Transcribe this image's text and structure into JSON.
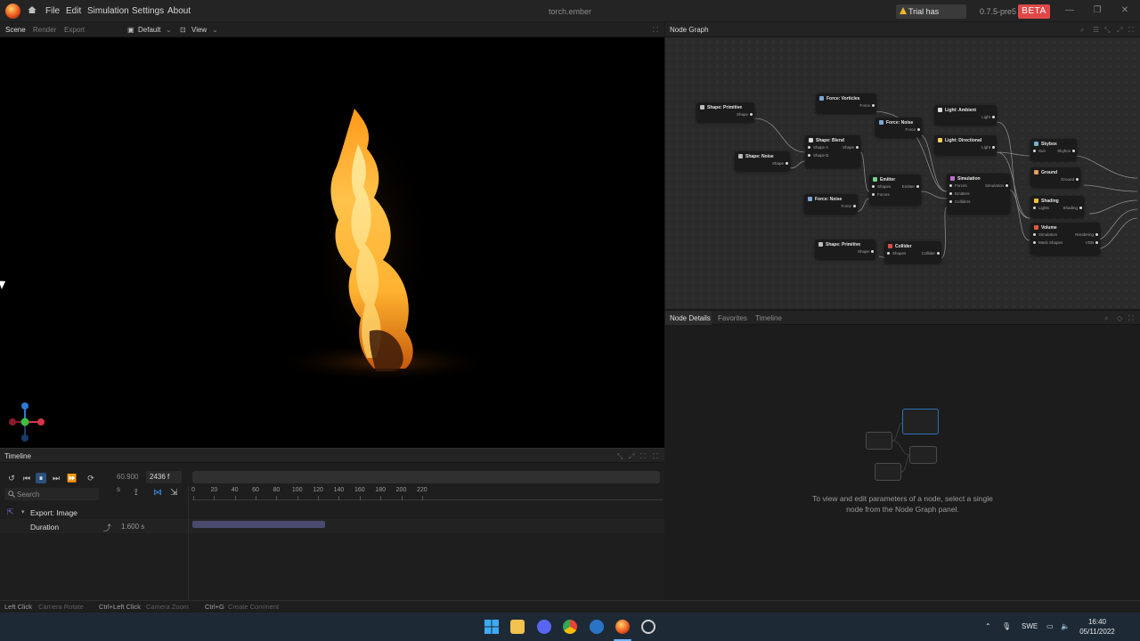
{
  "window": {
    "title": "torch.ember",
    "menu": [
      "File",
      "Edit",
      "Simulation",
      "Settings",
      "About"
    ],
    "trial_label": "Trial has expired",
    "version": "0.7.5-pre5",
    "beta_label": "BETA"
  },
  "scene": {
    "tabs": [
      "Scene",
      "Render",
      "Export"
    ],
    "camera_label": "Default",
    "view_label": "View"
  },
  "timeline": {
    "title": "Timeline",
    "time_value": "60.900 s",
    "frame_value": "2436 f",
    "search_placeholder": "Search",
    "ruler_ticks": [
      "0",
      "20",
      "40",
      "60",
      "80",
      "100",
      "120",
      "140",
      "160",
      "180",
      "200",
      "220"
    ],
    "export_label": "Export: Image",
    "duration_label": "Duration",
    "duration_value": "1.600 s"
  },
  "node_graph": {
    "title": "Node Graph",
    "nodes": [
      {
        "title": "Shape: Primitive",
        "outputs": [
          "Shape"
        ],
        "inputs": []
      },
      {
        "title": "Force: Vorticles",
        "outputs": [
          "Force"
        ],
        "inputs": []
      },
      {
        "title": "Force: Noise",
        "outputs": [
          "Force"
        ],
        "inputs": []
      },
      {
        "title": "Light: Ambient",
        "outputs": [
          "Light"
        ],
        "inputs": []
      },
      {
        "title": "Shape: Blend",
        "outputs": [
          "Shape"
        ],
        "inputs": [
          "Shape A",
          "Shape B"
        ]
      },
      {
        "title": "Light: Directional",
        "outputs": [
          "Light"
        ],
        "inputs": []
      },
      {
        "title": "Skybox",
        "outputs": [
          "Skybox"
        ],
        "inputs": [
          "Sun"
        ]
      },
      {
        "title": "Shape: Noise",
        "outputs": [
          "Shape"
        ],
        "inputs": []
      },
      {
        "title": "Emitter",
        "outputs": [
          "Emitter"
        ],
        "inputs": [
          "Shapes",
          "Forces"
        ]
      },
      {
        "title": "Simulation",
        "outputs": [
          "Simulation"
        ],
        "inputs": [
          "Forces",
          "Emitters",
          "Colliders"
        ]
      },
      {
        "title": "Ground",
        "outputs": [
          "Ground"
        ],
        "inputs": []
      },
      {
        "title": "Force: Noise",
        "outputs": [
          "Force"
        ],
        "inputs": []
      },
      {
        "title": "Shading",
        "outputs": [
          "Shading"
        ],
        "inputs": [
          "Lights"
        ]
      },
      {
        "title": "Volume",
        "outputs": [
          "Rendering",
          "VDB"
        ],
        "inputs": [
          "Simulation",
          "Mask Shapes"
        ]
      },
      {
        "title": "Shape: Primitive",
        "outputs": [
          "Shape"
        ],
        "inputs": []
      },
      {
        "title": "Collider",
        "outputs": [
          "Collider"
        ],
        "inputs": [
          "Shapes"
        ]
      }
    ]
  },
  "details": {
    "tabs": [
      "Node Details",
      "Favorites",
      "Timeline"
    ],
    "hint_line1": "To view and edit parameters of a node, select a single",
    "hint_line2": "node from the Node Graph panel."
  },
  "status": {
    "items": [
      {
        "key": "Left Click",
        "value": "Camera Rotate"
      },
      {
        "key": "Ctrl+Left Click",
        "value": "Camera Zoom"
      },
      {
        "key": "Ctrl+G",
        "value": "Create Comment"
      }
    ]
  },
  "taskbar": {
    "language": "SWE",
    "time": "16:40",
    "date": "05/11/2022"
  },
  "colors": {
    "beta": "#e04848",
    "accent": "#3a8ee6",
    "flame": "#ffb23a"
  }
}
